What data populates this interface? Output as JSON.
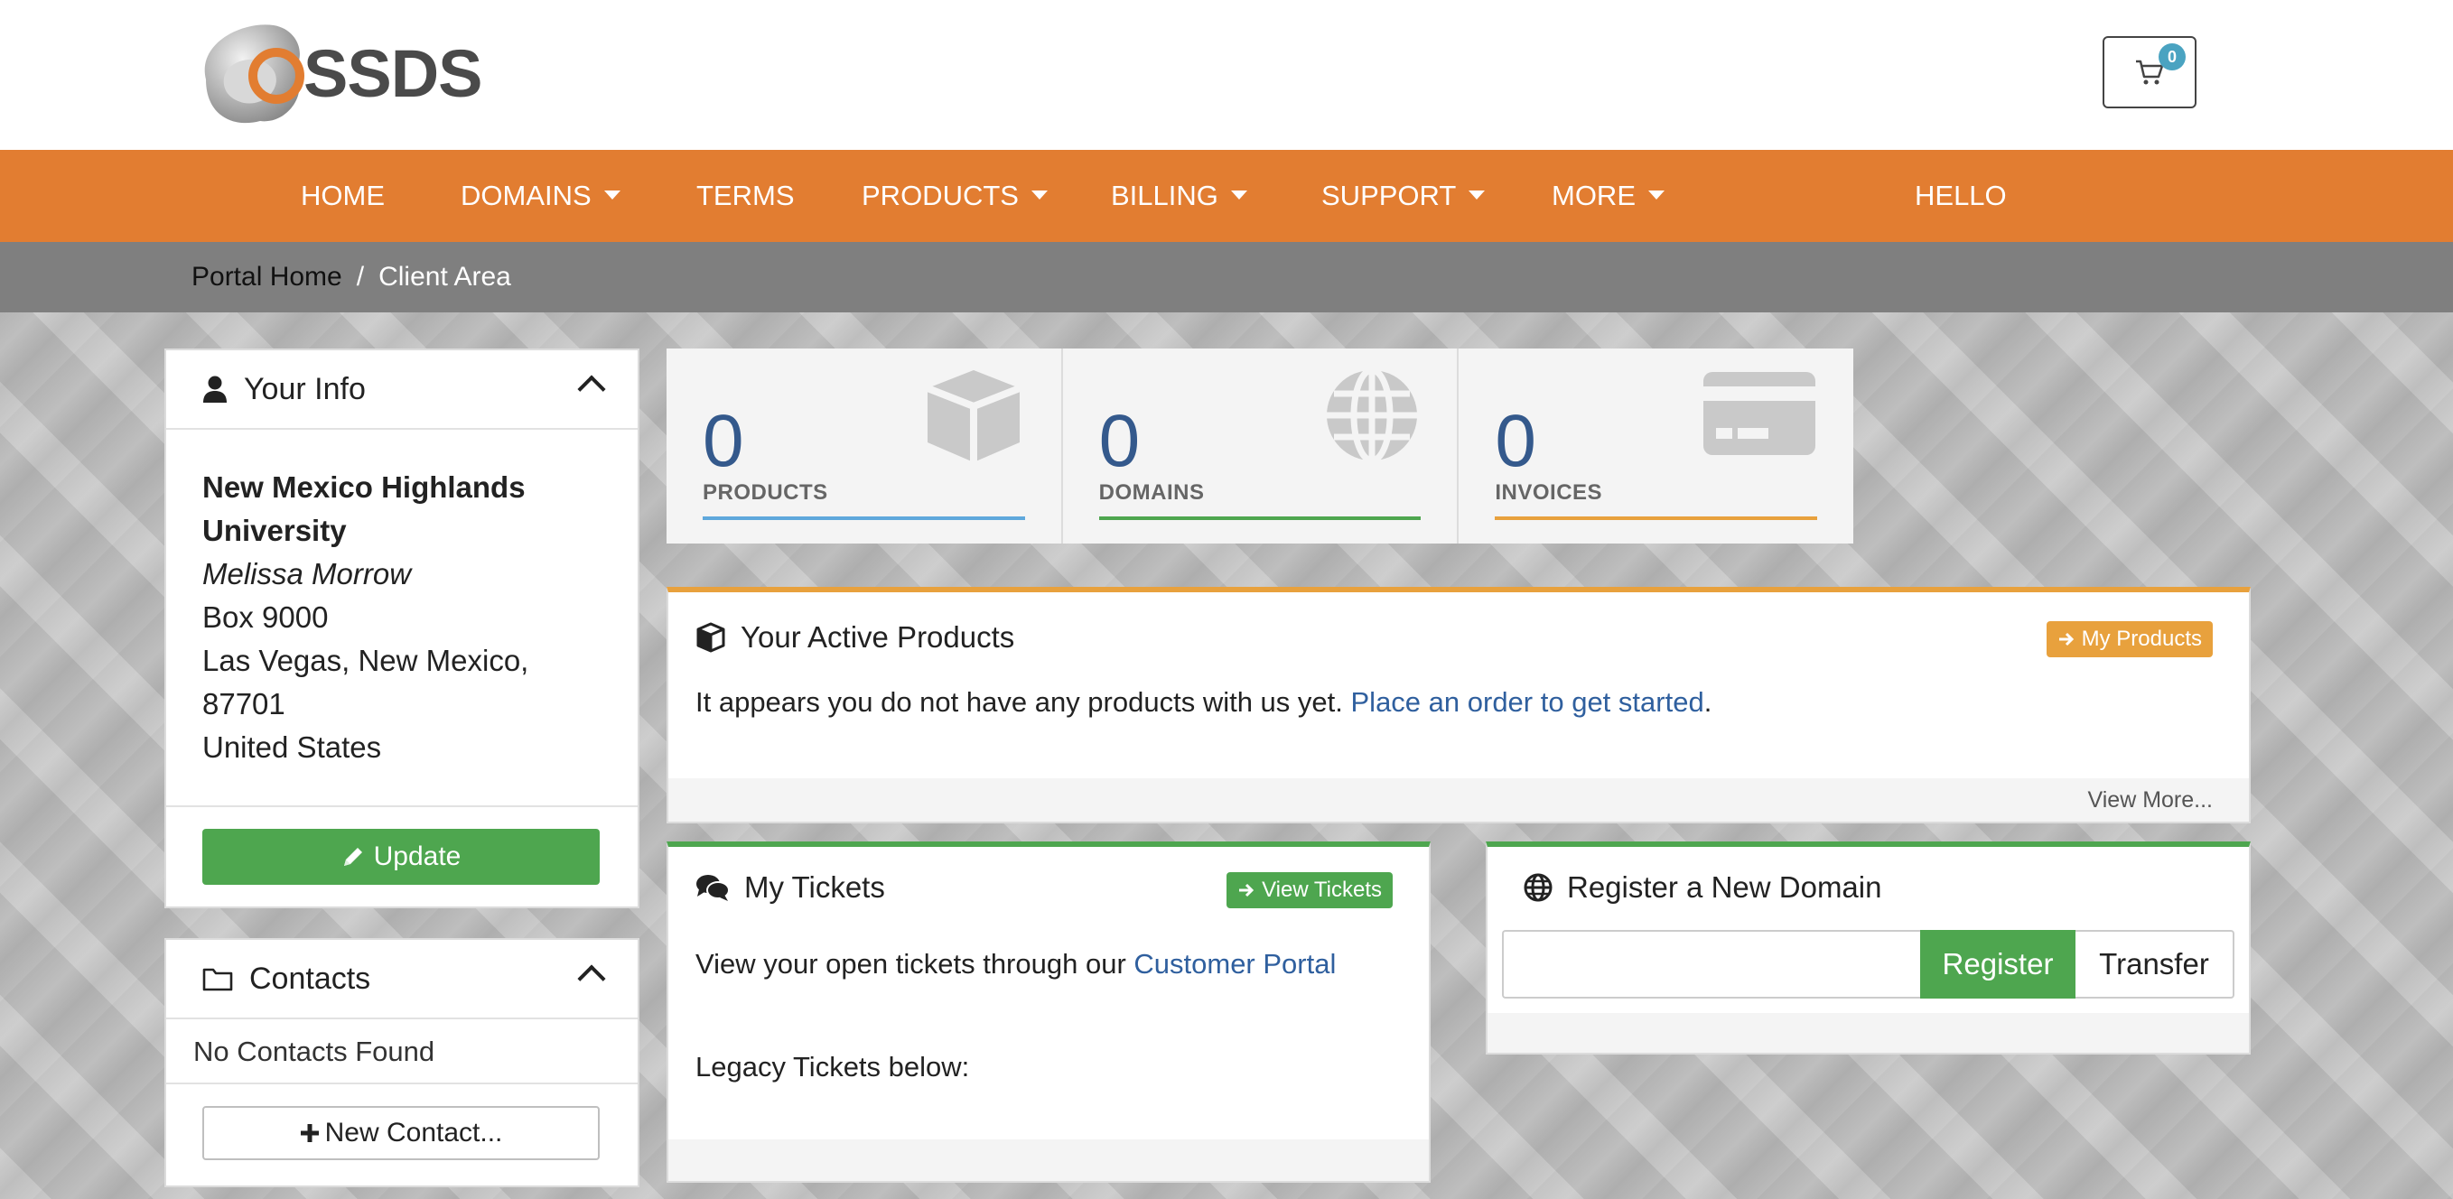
{
  "header": {
    "logo_text": "SSDS",
    "cart_count": "0"
  },
  "nav": {
    "items": [
      {
        "label": "HOME",
        "dropdown": false
      },
      {
        "label": "DOMAINS",
        "dropdown": true
      },
      {
        "label": "TERMS",
        "dropdown": false
      },
      {
        "label": "PRODUCTS",
        "dropdown": true
      },
      {
        "label": "BILLING",
        "dropdown": true
      },
      {
        "label": "SUPPORT",
        "dropdown": true
      },
      {
        "label": "MORE",
        "dropdown": true
      },
      {
        "label": "HELLO",
        "dropdown": false
      }
    ]
  },
  "breadcrumb": {
    "home": "Portal Home",
    "separator": "/",
    "current": "Client Area"
  },
  "your_info": {
    "title": "Your Info",
    "company": "New Mexico Highlands University",
    "name": "Melissa Morrow",
    "address1": "Box 9000",
    "city_state": "Las Vegas, New Mexico,",
    "postcode": "87701",
    "country": "United States",
    "update_label": "Update"
  },
  "contacts": {
    "title": "Contacts",
    "empty_text": "No Contacts Found",
    "new_label": "New Contact..."
  },
  "stats": {
    "products": {
      "value": "0",
      "label": "PRODUCTS",
      "color": "#5fa8dc"
    },
    "domains": {
      "value": "0",
      "label": "DOMAINS",
      "color": "#4ea64f"
    },
    "invoices": {
      "value": "0",
      "label": "INVOICES",
      "color": "#e8a13d"
    }
  },
  "active_products": {
    "title": "Your Active Products",
    "button": "My Products",
    "text": "It appears you do not have any products with us yet.",
    "link": "Place an order to get started",
    "link_suffix": ".",
    "view_more": "View More..."
  },
  "tickets": {
    "title": "My Tickets",
    "button": "View Tickets",
    "text": "View your open tickets through our",
    "link": "Customer Portal",
    "legacy": "Legacy Tickets below:"
  },
  "domain_register": {
    "title": "Register a New Domain",
    "input_value": "",
    "register_label": "Register",
    "transfer_label": "Transfer"
  },
  "colors": {
    "nav": "#e27d31",
    "accent_orange": "#e8a13d",
    "accent_green": "#4ea64f",
    "link_blue": "#2f5f9e"
  }
}
